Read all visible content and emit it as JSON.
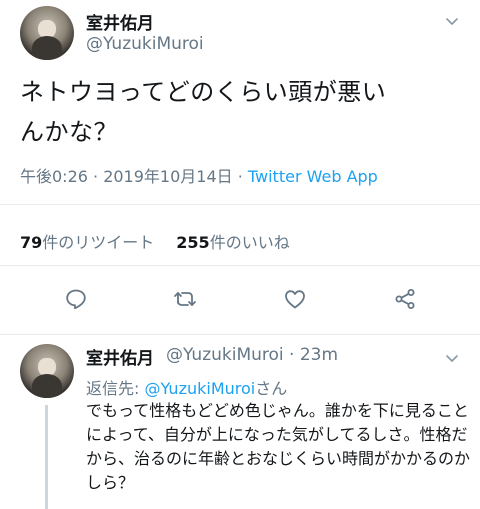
{
  "tweet": {
    "display_name": "室井佑月",
    "handle": "@YuzukiMuroi",
    "text_line1": "ネトウヨってどのくらい頭が悪い",
    "text_line2": "んかな？",
    "time": "午後0:26 · 2019年10月14日 · ",
    "app": "Twitter Web App",
    "retweet_count": "79",
    "retweet_label": "件のリツイート",
    "like_count": "255",
    "like_label": "件のいいね"
  },
  "actions": {
    "reply_icon": "reply-icon",
    "retweet_icon": "retweet-icon",
    "like_icon": "heart-icon",
    "share_icon": "share-icon"
  },
  "reply": {
    "display_name": "室井佑月",
    "handle": "@YuzukiMuroi",
    "age": " · 23m",
    "reply_to_prefix": "返信先: ",
    "reply_to_mention": "@YuzukiMuroi",
    "reply_to_suffix": "さん",
    "text": "でもって性格もどどめ色じゃん。誰かを下に見ることによって、自分が上になった気がしてるしさ。性格だから、治るのに年齢とおなじくらい時間がかかるのかしら？"
  },
  "colors": {
    "accent": "#1da1f2",
    "secondary_text": "#657786",
    "divider": "#e6ecf0"
  }
}
